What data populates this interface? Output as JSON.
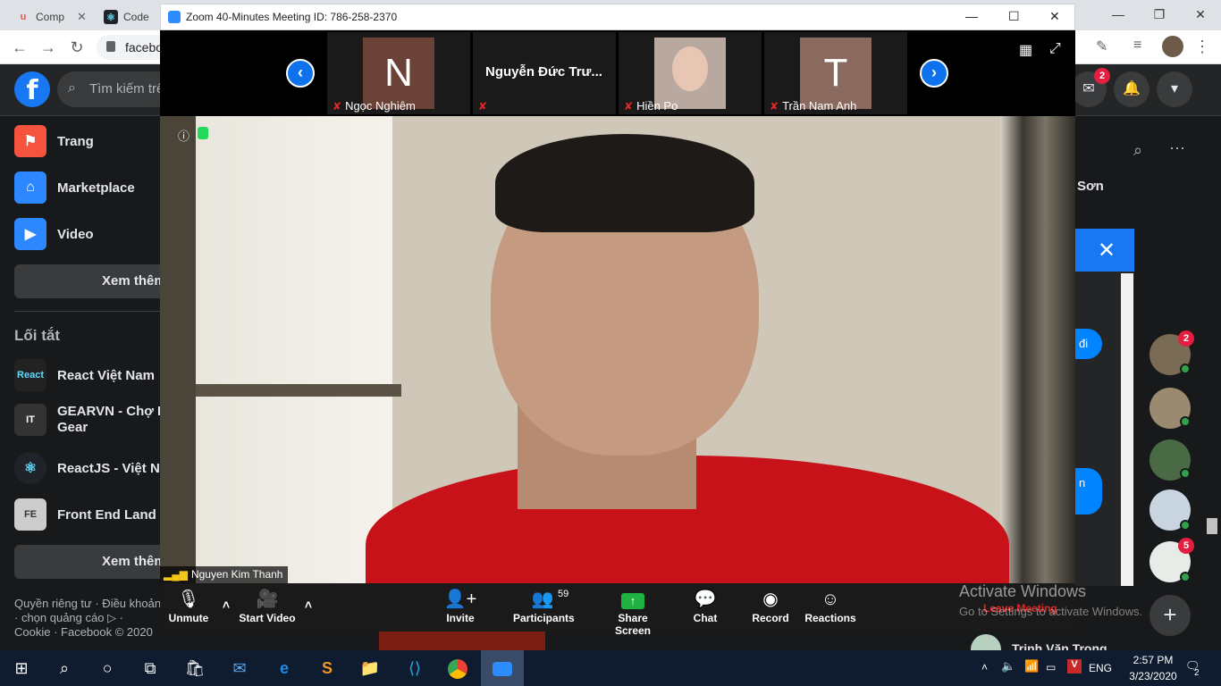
{
  "chrome": {
    "tabs": [
      {
        "title": "Comp",
        "icon": "udemy-icon"
      },
      {
        "title": "Code",
        "icon": "react-icon"
      }
    ],
    "omnibox_text": "facebo"
  },
  "facebook": {
    "search_placeholder": "Tìm kiếm trê",
    "messenger_badge": "2",
    "sidebar": [
      {
        "label": "Trang",
        "icon": "flag-icon"
      },
      {
        "label": "Marketplace",
        "icon": "store-icon"
      },
      {
        "label": "Video",
        "icon": "video-icon"
      }
    ],
    "see_more": "Xem thêm",
    "shortcuts_title": "Lối tắt",
    "shortcuts": [
      {
        "label": "React Việt Nam",
        "thumb": "React"
      },
      {
        "label": "GEARVN - Chợ P",
        "label2": "Gear",
        "thumb": "IT"
      },
      {
        "label": "ReactJS - Việt Na",
        "thumb": "⚛"
      },
      {
        "label": "Front End Land V",
        "thumb": "FE"
      }
    ],
    "see_more_2": "Xem thêm",
    "footer": "Quyền riêng tư · Điều khoản · chọn quảng cáo ▷ · Cookie · Facebook © 2020",
    "right_name": "Sơn",
    "chat_snippet_1": "đi",
    "chat_snippet_2": "n",
    "contact_badges": [
      "2",
      "5"
    ],
    "contact_bottom": "Trịnh Văn Trọng"
  },
  "zoom": {
    "title": "Zoom 40-Minutes Meeting ID: 786-258-2370",
    "participants_strip": [
      {
        "name": "Ngọc Nghiêm",
        "initial": "N",
        "color": "#6b4237"
      },
      {
        "name": "Nguyễn Đức Trư...",
        "initial": "",
        "color": "#1a1a1a"
      },
      {
        "name": "Hiền Po",
        "initial": "",
        "color": "#b9a8a0"
      },
      {
        "name": "Trần Nam Anh",
        "initial": "T",
        "color": "#8a6a5e"
      }
    ],
    "active_speaker": "Nguyen Kim Thanh",
    "toolbar": {
      "unmute": "Unmute",
      "start_video": "Start Video",
      "invite": "Invite",
      "participants": "Participants",
      "participants_count": "59",
      "share_screen": "Share Screen",
      "chat": "Chat",
      "record": "Record",
      "reactions": "Reactions",
      "leave": "Leave Meeting"
    }
  },
  "windows": {
    "activate_title": "Activate Windows",
    "activate_sub": "Go to Settings to activate Windows.",
    "lang": "ENG",
    "time": "2:57 PM",
    "date": "3/23/2020",
    "notifications": "2"
  }
}
